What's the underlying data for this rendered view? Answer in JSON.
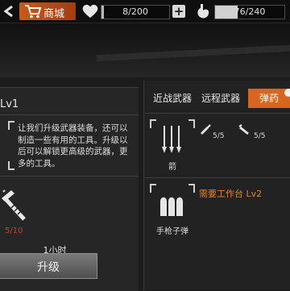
{
  "topbar": {
    "shop_label": "商城",
    "health": {
      "text": "8/200",
      "fraction": 0.04
    },
    "hunger": {
      "text": "76/240",
      "fraction": 0.32
    }
  },
  "left": {
    "title": "Lv1",
    "description": "让我们升级武器装备，还可以制造一些有用的工具。升级以后可以解锁更高级的武器，更多的工具。",
    "material_count": "5/10",
    "duration": "1小时",
    "upgrade_label": "升级"
  },
  "right": {
    "tabs": [
      {
        "label": "近战武器",
        "active": false
      },
      {
        "label": "远程武器",
        "active": false
      },
      {
        "label": "弹药",
        "active": true
      }
    ],
    "item_arrows": {
      "name": "箭",
      "mat1_count": "5/5",
      "mat2_count": "5/5"
    },
    "item_pistol": {
      "name": "手枪子弹",
      "requirement": "需要工作台 Lv2"
    }
  },
  "colors": {
    "accent": "#d8661e",
    "warning": "#d23a2a",
    "requirement": "#e0862b"
  },
  "icons": [
    "back-arrow-icon",
    "shopping-cart-icon",
    "heart-icon",
    "plus-icon",
    "stomach-icon",
    "hammer-icon",
    "arrows-icon",
    "bullets-icon"
  ]
}
